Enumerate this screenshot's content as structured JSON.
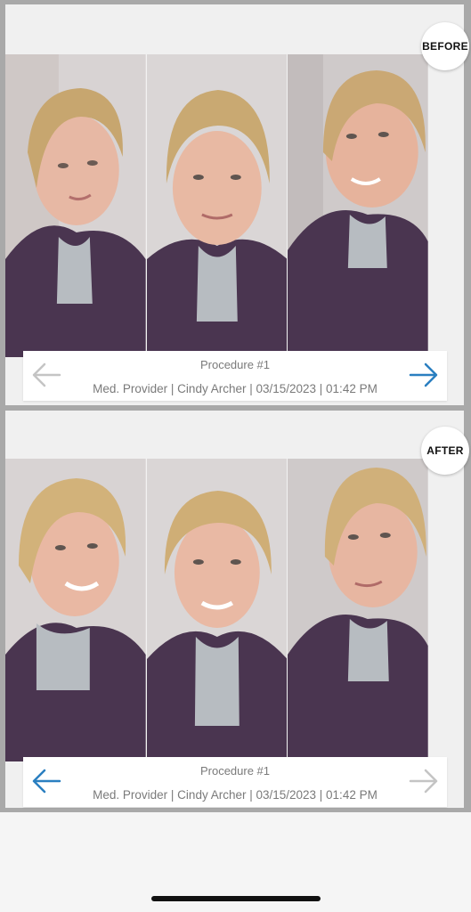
{
  "colors": {
    "accent": "#2a7fc0",
    "inactive_arrow": "#c4c4c4",
    "caption_text": "#7a7a7a"
  },
  "before": {
    "badge": "BEFORE",
    "caption_title": "Procedure #1",
    "caption_meta": "Med. Provider | Cindy Archer | 03/15/2023 | 01:42 PM",
    "left_arrow_state": "inactive",
    "right_arrow_state": "active",
    "photos": [
      "face-three-quarter-left",
      "face-front",
      "face-three-quarter-right"
    ]
  },
  "after": {
    "badge": "AFTER",
    "caption_title": "Procedure #1",
    "caption_meta": "Med. Provider | Cindy Archer | 03/15/2023 | 01:42 PM",
    "left_arrow_state": "active",
    "right_arrow_state": "inactive",
    "photos": [
      "face-three-quarter-left",
      "face-front",
      "face-three-quarter-right"
    ]
  }
}
